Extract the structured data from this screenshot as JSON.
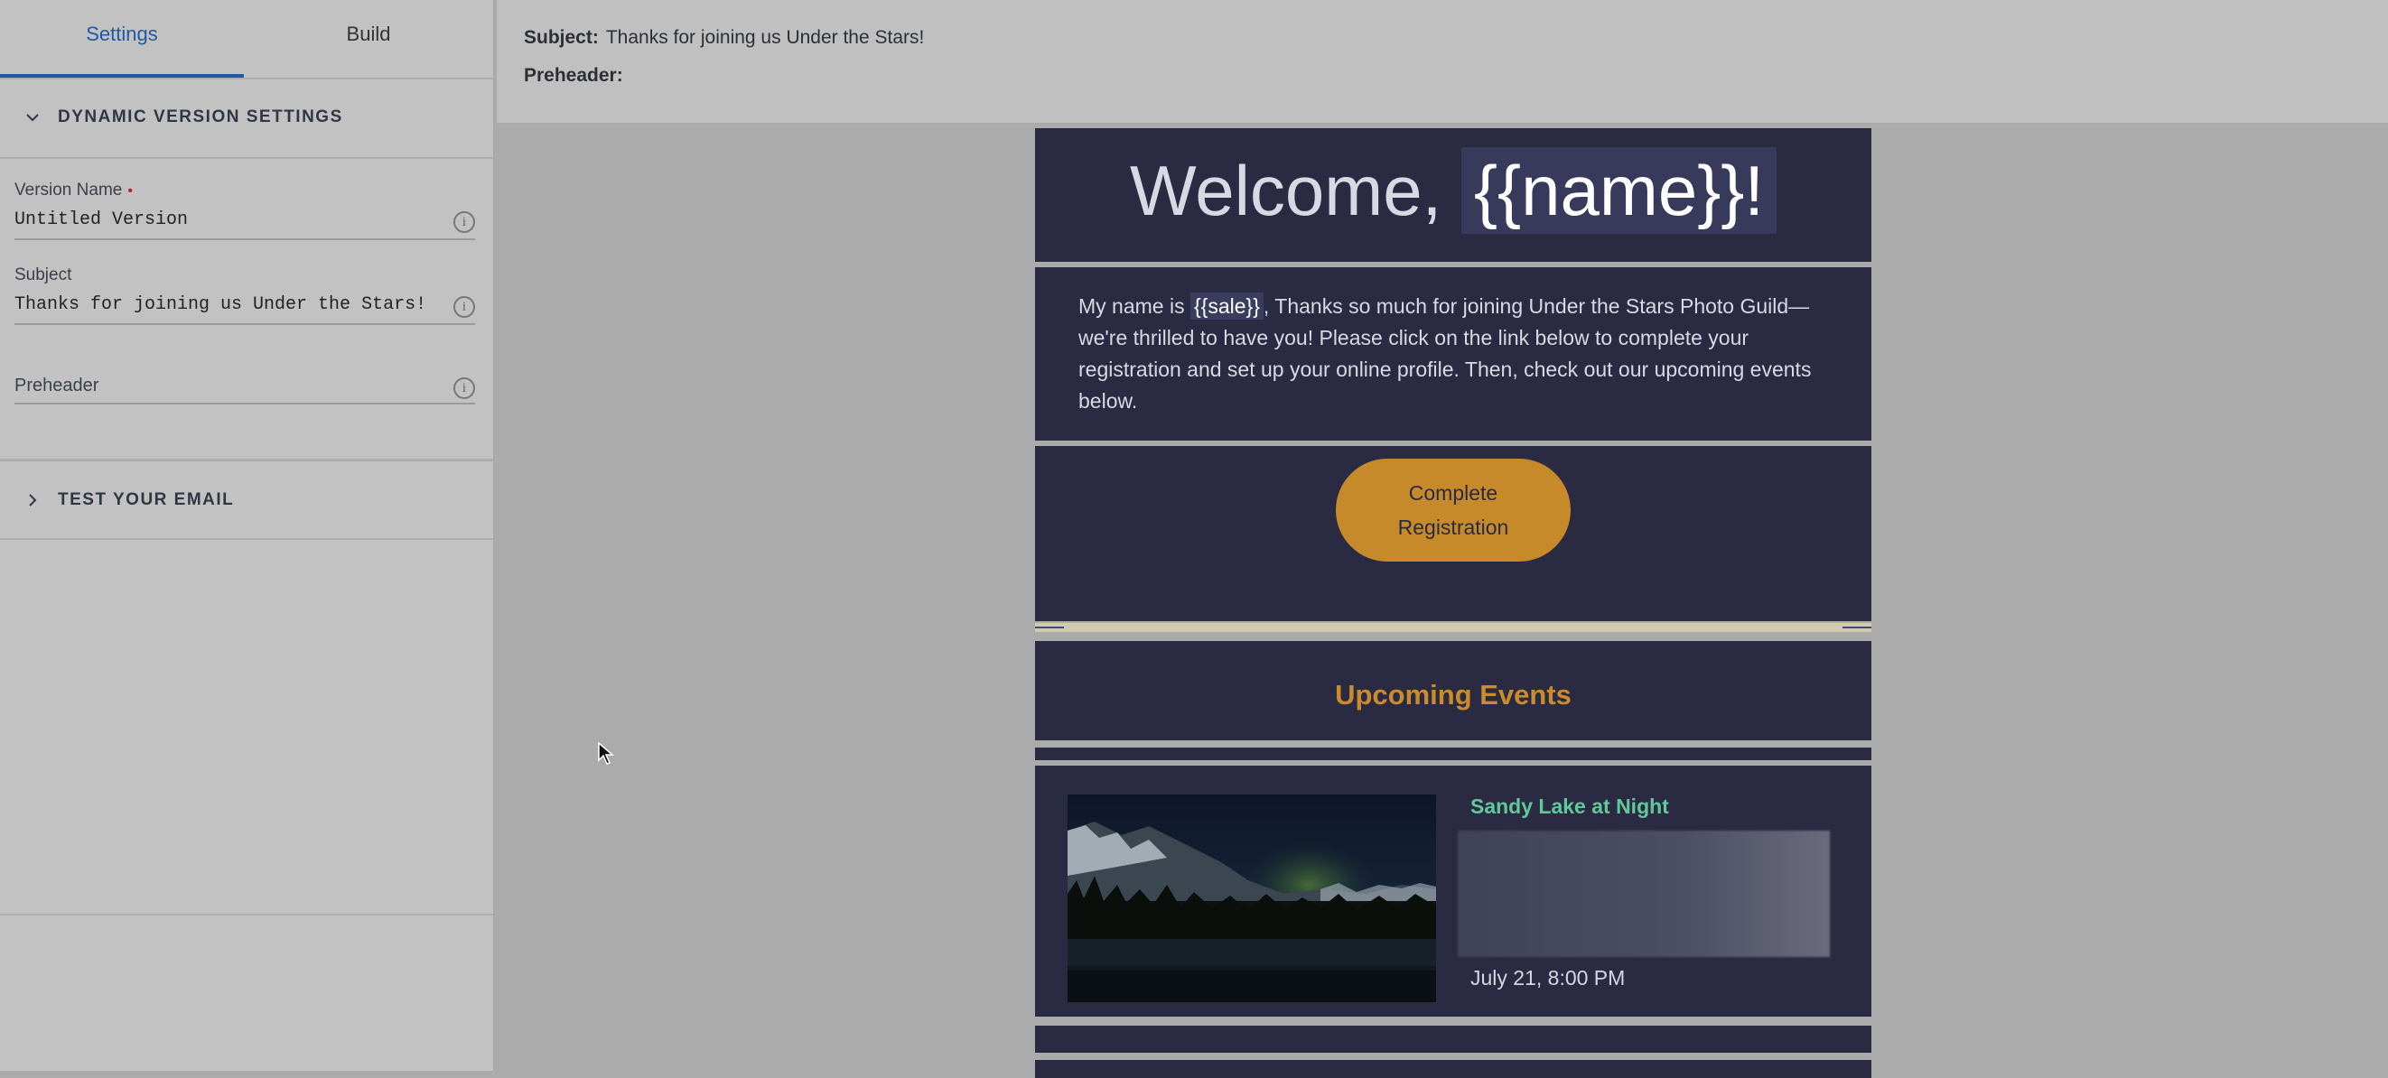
{
  "left_panel": {
    "tabs": [
      {
        "label": "Settings",
        "active": true
      },
      {
        "label": "Build",
        "active": false
      }
    ],
    "dynamic_section": {
      "title": "DYNAMIC VERSION SETTINGS",
      "expanded": true
    },
    "fields": {
      "version_name": {
        "label": "Version Name",
        "required_mark": "•",
        "value": "Untitled Version"
      },
      "subject": {
        "label": "Subject",
        "value": "Thanks for joining us Under the Stars!"
      },
      "preheader": {
        "label": "Preheader",
        "value": ""
      }
    },
    "test_section": {
      "title": "TEST YOUR EMAIL",
      "expanded": false
    }
  },
  "preview_header": {
    "subject_label": "Subject:",
    "subject_value": "Thanks for joining us Under the Stars!",
    "preheader_label": "Preheader:",
    "preheader_value": ""
  },
  "email": {
    "welcome_prefix": "Welcome,",
    "welcome_tag": "{{name}}!",
    "intro_before": "My name is",
    "intro_tag": "{{sale}}",
    "intro_after": ", Thanks so much for joining Under the Stars Photo Guild—we're thrilled to have you! Please click on the link below to complete your registration and set up your online profile. Then, check out our upcoming events below.",
    "cta_line1": "Complete",
    "cta_line2": "Registration",
    "upcoming_title": "Upcoming Events",
    "event": {
      "title": "Sandy Lake at Night",
      "date": "July 21, 8:00 PM"
    }
  },
  "colors": {
    "accent_blue": "#1e5aa6",
    "email_bg": "#2a2b43",
    "cta_gold": "#c68a2a",
    "event_green": "#62c89a",
    "required_red": "#b4202e"
  },
  "icons": {
    "chevron_down": "chevron-down-icon",
    "chevron_right": "chevron-right-icon",
    "info": "info-icon",
    "cursor": "mouse-cursor-icon"
  }
}
